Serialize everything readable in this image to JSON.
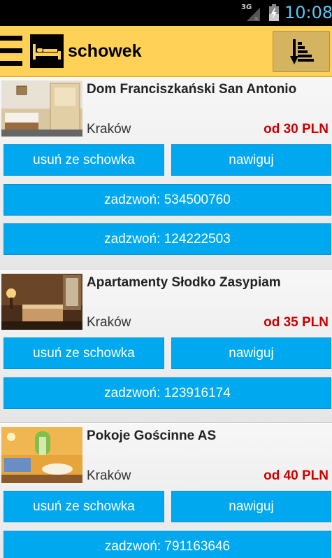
{
  "status_bar": {
    "network": "3G",
    "time": "10:08"
  },
  "action_bar": {
    "title": "schowek",
    "menu_icon": "hamburger-icon",
    "logo_icon": "bed-icon",
    "sort_icon": "sort-descending-icon"
  },
  "colors": {
    "action_bar": "#ffd257",
    "button": "#00a8ef",
    "price": "#cc0000",
    "clock": "#5bc8f5"
  },
  "listings": [
    {
      "name": "Dom Franciszkański San Antonio",
      "city": "Kraków",
      "price": "od 30 PLN",
      "remove_label": "usuń ze schowka",
      "navigate_label": "nawiguj",
      "calls": [
        "zadzwoń: 534500760",
        "zadzwoń: 124222503"
      ]
    },
    {
      "name": "Apartamenty Słodko Zasypiam",
      "city": "Kraków",
      "price": "od 35 PLN",
      "remove_label": "usuń ze schowka",
      "navigate_label": "nawiguj",
      "calls": [
        "zadzwoń: 123916174"
      ]
    },
    {
      "name": "Pokoje Gościnne AS",
      "city": "Kraków",
      "price": "od 40 PLN",
      "remove_label": "usuń ze schowka",
      "navigate_label": "nawiguj",
      "calls": [
        "zadzwoń: 791163646"
      ]
    }
  ]
}
